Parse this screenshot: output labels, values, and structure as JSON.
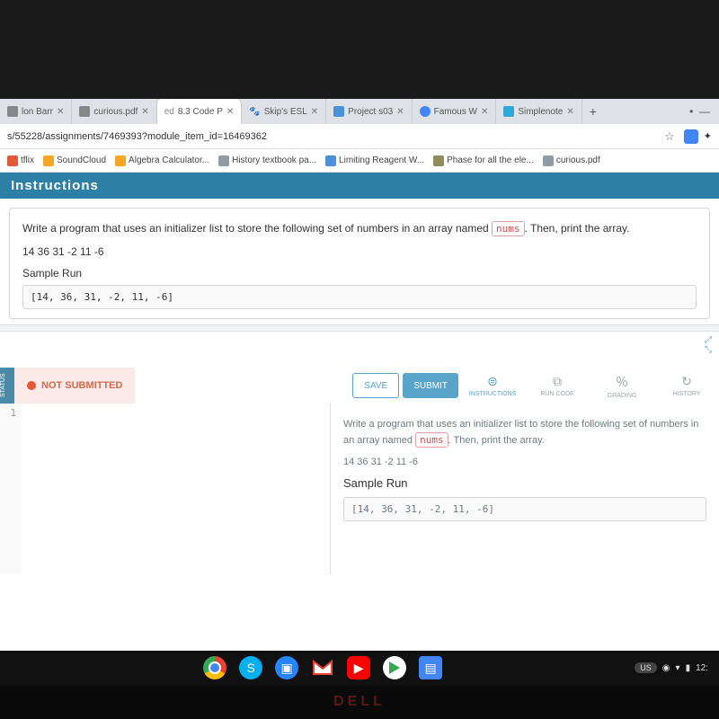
{
  "tabs": [
    {
      "label": "lon Barr",
      "fav": "f-g"
    },
    {
      "label": "curious.pdf",
      "fav": "f-g"
    },
    {
      "label": "8.3 Code P",
      "fav": "f-g",
      "active": true,
      "prefix": "ed"
    },
    {
      "label": "Skip's ESL",
      "fav": "f-g"
    },
    {
      "label": "Project s03",
      "fav": "f-b"
    },
    {
      "label": "Famous W",
      "fav": "f-c"
    },
    {
      "label": "Simplenote",
      "fav": "f-s"
    }
  ],
  "url": "s/55228/assignments/7469393?module_item_id=16469362",
  "bookmarks": [
    {
      "label": "tflix",
      "cls": "bm-r"
    },
    {
      "label": "SoundCloud",
      "cls": "bm-o"
    },
    {
      "label": "Algebra Calculator...",
      "cls": "bm-o"
    },
    {
      "label": "History textbook pa...",
      "cls": "bm-g"
    },
    {
      "label": "Limiting Reagent W...",
      "cls": "bm-b"
    },
    {
      "label": "Phase for all the ele...",
      "cls": "bm-p"
    },
    {
      "label": "curious.pdf",
      "cls": "bm-g"
    }
  ],
  "banner": "Instructions",
  "prompt": {
    "pre": "Write a program that uses an initializer list to store the following set of numbers in an array named ",
    "chip": "nums",
    "post": ". Then, print the array.",
    "numbers": "14 36 31 -2 11 -6",
    "sample_h": "Sample Run",
    "sample_out": "[14, 36, 31, -2, 11, -6]"
  },
  "status": {
    "tab": "STATUS",
    "label": "NOT SUBMITTED"
  },
  "buttons": {
    "save": "SAVE",
    "submit": "SUBMIT"
  },
  "tb": {
    "instructions": "INSTRUCTIONS",
    "run": "RUN CODE",
    "grading": "GRADING",
    "history": "HISTORY"
  },
  "editor": {
    "line1": "1"
  },
  "tray": {
    "lang": "US",
    "time": "12:"
  },
  "brand": "DELL"
}
